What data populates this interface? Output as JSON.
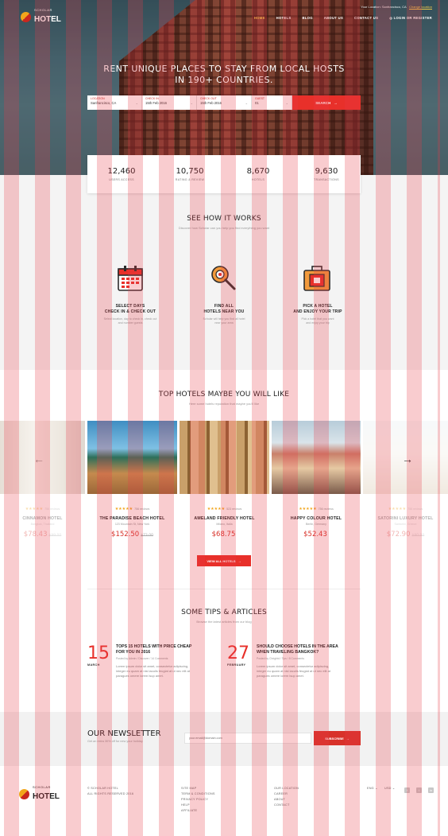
{
  "brand": {
    "small": "SCHOLAR",
    "big": "HOTEL",
    "colors": {
      "accent": "#e8302a",
      "star": "#f2a51b"
    }
  },
  "topbar": {
    "location_label": "Your Location: Sanfrancisco, CA",
    "change_link": "Change location"
  },
  "nav": {
    "items": [
      "HOME",
      "HOTELS",
      "BLOG",
      "ABOUT US",
      "CONTACT US"
    ],
    "login": "LOGIN OR REGISTER"
  },
  "hero": {
    "line1": "RENT UNIQUE PLACES TO STAY FROM LOCAL HOSTS",
    "line2": "IN 190+ COUNTRIES."
  },
  "search": {
    "fields": [
      {
        "label": "LOCATION",
        "value": "Sanfrancisco, CA"
      },
      {
        "label": "CHECK IN",
        "value": "15th Feb 2016"
      },
      {
        "label": "CHECK OUT",
        "value": "15th Feb 2016"
      },
      {
        "label": "GUEST",
        "value": "01"
      }
    ],
    "button": "SEARCH"
  },
  "stats": [
    {
      "num": "12,460",
      "label": "USERS ACCESS"
    },
    {
      "num": "10,750",
      "label": "RATING & REVIEW"
    },
    {
      "num": "8,670",
      "label": "HOTELS"
    },
    {
      "num": "9,630",
      "label": "TRANSACTIONS"
    }
  ],
  "how": {
    "title": "SEE HOW IT WORKS",
    "subtitle": "Discover how Scholar can you help you find everything you want",
    "steps": [
      {
        "icon": "calendar-icon",
        "l1": "SELECT DAYS",
        "l2": "CHECK IN & CHECK OUT",
        "d1": "Select location, day to check in, check out",
        "d2": "and number guests"
      },
      {
        "icon": "map-search-icon",
        "l1": "FIND ALL",
        "l2": "HOTELS NEAR YOU",
        "d1": "Scholar will help you find all hotel",
        "d2": "near your area"
      },
      {
        "icon": "suitcase-icon",
        "l1": "PICK A HOTEL",
        "l2": "AND ENJOY YOUR TRIP",
        "d1": "Pick a hotel that you want",
        "d2": "and enjoy your trip"
      }
    ]
  },
  "hotels": {
    "title": "TOP HOTELS MAYBE YOU WILL LIKE",
    "subtitle": "Here some hotels reputation that maybe you'll like",
    "cards": [
      {
        "name": "CINNAMON HOTEL",
        "loc": "Bangkok, Thailand",
        "reviews": "756 reviews",
        "price": "$78.43",
        "old": "$99.00",
        "stars": "★★★★★"
      },
      {
        "name": "THE PARADISE BEACH HOTEL",
        "loc": "123 Mountain St, New York",
        "reviews": "756 reviews",
        "price": "$152.50",
        "old": "$73.00",
        "stars": "★★★★★"
      },
      {
        "name": "AMELAND FRIENDLY HOTEL",
        "loc": "Milano, Italia",
        "reviews": "523 reviews",
        "price": "$68.75",
        "old": "",
        "stars": "★★★★★"
      },
      {
        "name": "HAPPY COLOUR HOTEL",
        "loc": "Berlin, Germany",
        "reviews": "756 reviews",
        "price": "$52.43",
        "old": "",
        "stars": "★★★★★"
      },
      {
        "name": "SATORINI LUXURY HOTEL",
        "loc": "Santorini, Greece",
        "reviews": "756 reviews",
        "price": "$72.90",
        "old": "$80.00",
        "stars": "★★★★★"
      }
    ],
    "view_all": "VIEW ALL HOTELS"
  },
  "tips": {
    "title": "SOME TIPS & ARTICLES",
    "subtitle": "Browse the latest articles from our blog",
    "articles": [
      {
        "day": "15",
        "month": "MARCH",
        "t1": "TOPS 15 HOTELS WITH PRICE CHEAP",
        "t2": "FOR YOU IN 2016",
        "meta": "Posted by Admin  /  Discover  /  14 Comments",
        "x1": "Lorem ipsum dolor sit amet, consectetur adipiscing,",
        "x2": "integer eu quam at nisl iaculis feugiat at ut nec elit at",
        "x3": "paragues omere lorem isup amet."
      },
      {
        "day": "27",
        "month": "FEBRUARY",
        "t1": "SHOULD CHOOSE HOTELS IN THE AREA",
        "t2": "WHEN TRAVELING BANGKOK?",
        "meta": "Posted by Chrightd  /  Tips  /  8 Comments",
        "x1": "Lorem ipsum dolor sit amet, consectetur adipiscing,",
        "x2": "integer eu quam at nisl iaculis feugiat at ut nec elit at",
        "x3": "paragues omere lorem isup amet."
      }
    ]
  },
  "newsletter": {
    "title": "OUR NEWSLETTER",
    "subtitle": "Get an extra 30% off for new your holiday",
    "placeholder": "your.email@domain.com",
    "button": "SUBSCRIBE"
  },
  "footer": {
    "copy1": "© SCHOLAR HOTEL",
    "copy2": "ALL RIGHTS RESERVED 2016",
    "links1": [
      "SITE MAP",
      "TERM & CONDITIONS",
      "PRIVACY POLICY",
      "HELP",
      "AFFILIATE"
    ],
    "links2": [
      "OUR LOCATION",
      "CAREER",
      "ABOUT",
      "CONTACT"
    ],
    "lang": "ENG",
    "currency": "USD",
    "social": [
      "f",
      "t",
      "in"
    ]
  }
}
